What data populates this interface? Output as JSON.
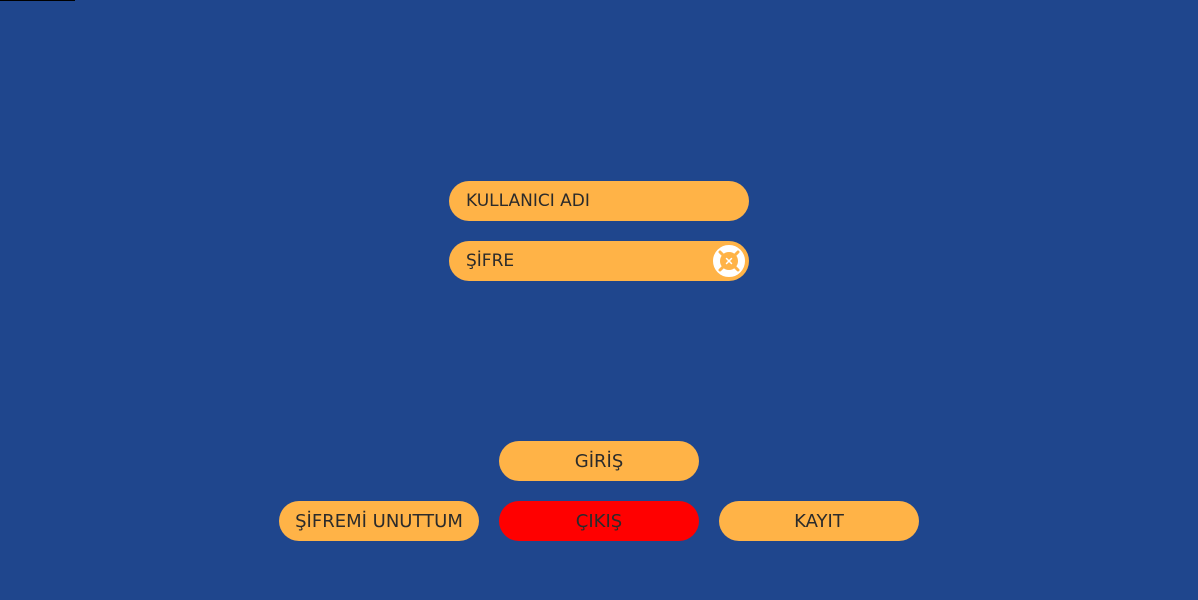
{
  "colors": {
    "background": "#1f468d",
    "accent": "#ffb347",
    "danger": "#ff0000",
    "text": "#2b2b2b",
    "icon": "#ffffff"
  },
  "login_form": {
    "username_placeholder": "KULLANICI ADI",
    "password_placeholder": "ŞİFRE",
    "password_toggle_icon": "lifebuoy-icon"
  },
  "buttons": {
    "login_label": "GİRİŞ",
    "forgot_password_label": "ŞİFREMİ UNUTTUM",
    "exit_label": "ÇIKIŞ",
    "register_label": "KAYIT"
  }
}
